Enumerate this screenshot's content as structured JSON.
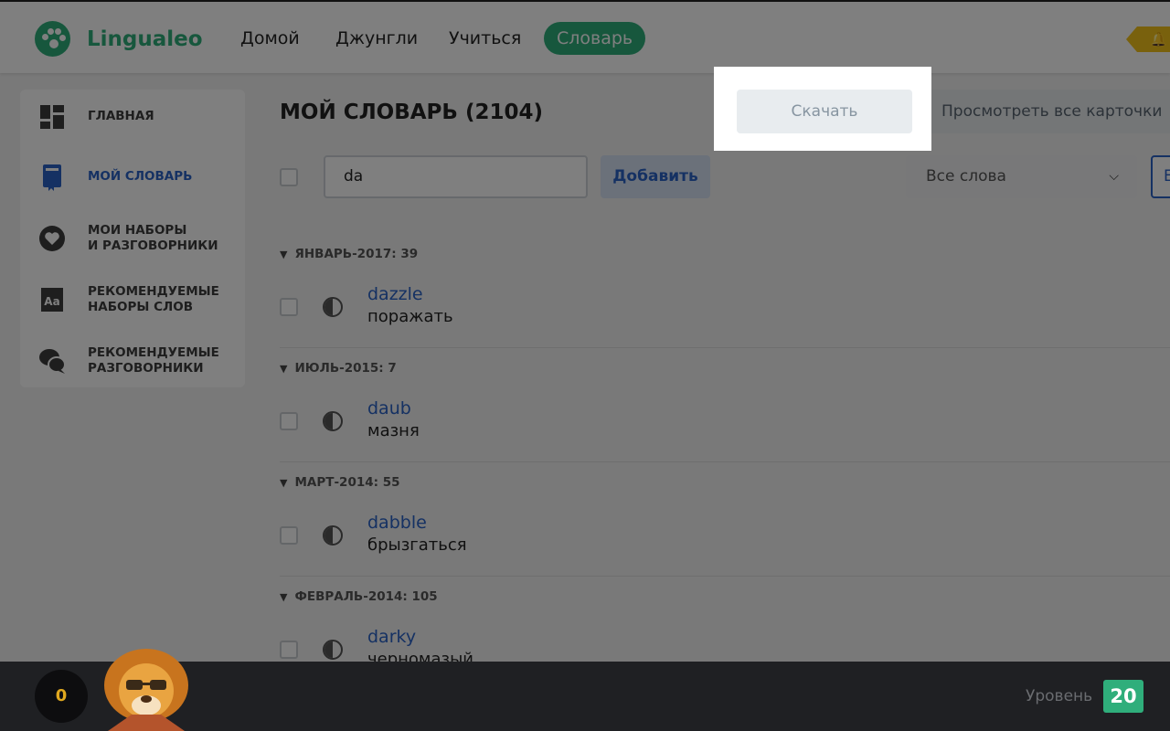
{
  "header": {
    "logo_text": "Lingualeo",
    "nav": [
      "Домой",
      "Джунгли",
      "Учиться",
      "Словарь"
    ],
    "active_nav": "Словарь"
  },
  "sidebar": {
    "items": [
      {
        "label": "ГЛАВНАЯ",
        "icon": "dashboard-icon"
      },
      {
        "label": "МОЙ СЛОВАРЬ",
        "icon": "dictionary-book-icon",
        "active": true
      },
      {
        "label_lines": [
          "МОИ НАБОРЫ",
          "И РАЗГОВОРНИКИ"
        ],
        "icon": "heart-icon"
      },
      {
        "label_lines": [
          "РЕКОМЕНДУЕМЫЕ",
          "НАБОРЫ СЛОВ"
        ],
        "icon": "word-set-icon"
      },
      {
        "label_lines": [
          "РЕКОМЕНДУЕМЫЕ",
          "РАЗГОВОРНИКИ"
        ],
        "icon": "chat-bubbles-icon"
      }
    ]
  },
  "main": {
    "title": "МОЙ СЛОВАРЬ (2104)",
    "download_label": "Скачать",
    "view_cards_label": "Просмотреть все карточки",
    "search_value": "da",
    "add_label": "Добавить",
    "filter_selected": "Все слова",
    "edge_button_char": "E",
    "groups": [
      {
        "heading": "ЯНВАРЬ-2017: 39",
        "word": "dazzle",
        "translation": "поражать"
      },
      {
        "heading": "ИЮЛЬ-2015: 7",
        "word": "daub",
        "translation": "мазня"
      },
      {
        "heading": "МАРТ-2014: 55",
        "word": "dabble",
        "translation": "брызгаться"
      },
      {
        "heading": "ФЕВРАЛЬ-2014: 105",
        "word": "darky",
        "translation": "черномазый"
      }
    ]
  },
  "footer": {
    "coins": "0",
    "level_label": "Уровень",
    "level_value": "20"
  },
  "colors": {
    "brand_green": "#2fae7b",
    "link_blue": "#2b63c6",
    "overlay": "rgba(0,0,0,0.5)"
  }
}
